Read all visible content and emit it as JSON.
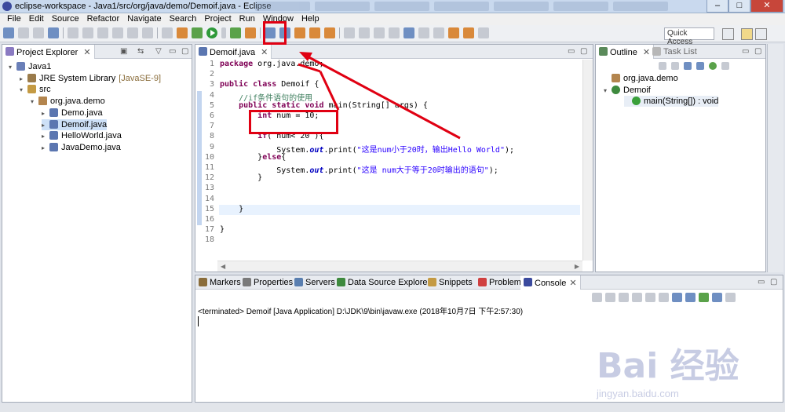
{
  "window": {
    "title": "eclipse-workspace - Java1/src/org/java/demo/Demoif.java - Eclipse",
    "controls": [
      "–",
      "□",
      "✕"
    ]
  },
  "menubar": [
    "File",
    "Edit",
    "Source",
    "Refactor",
    "Navigate",
    "Search",
    "Project",
    "Run",
    "Window",
    "Help"
  ],
  "toolbar": {
    "quick_access": "Quick Access",
    "icons": [
      "new-icon",
      "save-icon",
      "print-icon",
      "debug-icon",
      "run-icon",
      "coverage-icon",
      "external-tools-icon",
      "new-java-project-icon",
      "open-type-icon",
      "search-icon",
      "next-annotation-icon",
      "back-icon",
      "forward-icon"
    ]
  },
  "project_explorer": {
    "tab_label": "Project Explorer",
    "close": "✕",
    "tree": [
      {
        "label": "Java1",
        "icon": "project-icon",
        "depth": 0,
        "toggle": "▾"
      },
      {
        "label": "JRE System Library",
        "suffix": "[JavaSE-9]",
        "icon": "library-icon",
        "depth": 1,
        "toggle": "▸"
      },
      {
        "label": "src",
        "icon": "source-folder-icon",
        "depth": 1,
        "toggle": "▾"
      },
      {
        "label": "org.java.demo",
        "icon": "package-icon",
        "depth": 2,
        "toggle": "▾"
      },
      {
        "label": "Demo.java",
        "icon": "java-file-icon",
        "depth": 3,
        "toggle": "▸"
      },
      {
        "label": "Demoif.java",
        "icon": "java-file-icon",
        "depth": 3,
        "toggle": "▸",
        "selected": true
      },
      {
        "label": "HelloWorld.java",
        "icon": "java-file-icon",
        "depth": 3,
        "toggle": "▸"
      },
      {
        "label": "JavaDemo.java",
        "icon": "java-file-icon",
        "depth": 3,
        "toggle": "▸"
      }
    ]
  },
  "editor": {
    "tab_label": "Demoif.java",
    "close": "✕",
    "lines": [
      "package org.java.demo;",
      "",
      "public class Demoif {",
      "    //if条件语句的使用",
      "    public static void main(String[] args) {",
      "        int num = 10;",
      "",
      "        if( num< 20 ){",
      "            System.out.print(\"这是num小于20时，输出Hello World\");",
      "        }else{",
      "            System.out.print(\"这是 num大于等于20时输出的语句\");",
      "        }",
      "",
      "",
      "    }",
      "",
      "}",
      ""
    ],
    "cursor_line": 15
  },
  "outline": {
    "tab_label": "Outline",
    "task_tab_label": "Task List",
    "close": "✕",
    "items": [
      {
        "label": "org.java.demo",
        "icon": "package-icon",
        "depth": 0
      },
      {
        "label": "Demoif",
        "icon": "class-icon",
        "depth": 0,
        "toggle": "▾"
      },
      {
        "label": "main(String[]) : void",
        "icon": "method-icon",
        "depth": 1
      }
    ]
  },
  "console": {
    "tabs": [
      "Markers",
      "Properties",
      "Servers",
      "Data Source Explorer",
      "Snippets",
      "Problems",
      "Console"
    ],
    "active_tab": "Console",
    "close": "✕",
    "status_line": "<terminated> Demoif [Java Application] D:\\JDK\\9\\bin\\javaw.exe (2018年10月7日 下午2:57:30)"
  },
  "watermark": {
    "logo": "Bai 经验",
    "url": "jingyan.baidu.com"
  },
  "colors": {
    "annotation_red": "#e00012",
    "run_green": "#2f9a3a",
    "keyword": "#7f0055",
    "string": "#2a00ff",
    "comment": "#3f7f5f"
  }
}
